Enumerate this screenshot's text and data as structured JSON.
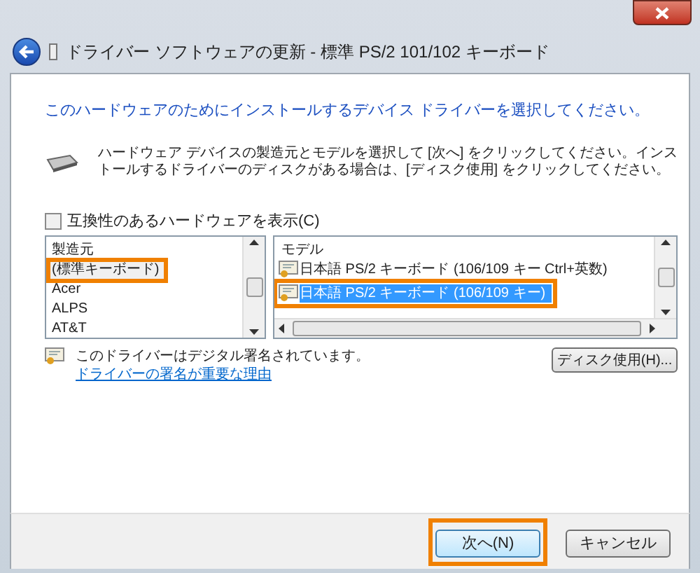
{
  "window": {
    "title": "ドライバー ソフトウェアの更新 - 標準 PS/2 101/102 キーボード"
  },
  "heading": "このハードウェアのためにインストールするデバイス ドライバーを選択してください。",
  "description": "ハードウェア デバイスの製造元とモデルを選択して [次へ] をクリックしてください。インストールするドライバーのディスクがある場合は、[ディスク使用] をクリックしてください。",
  "compatible_checkbox": {
    "label": "互換性のあるハードウェアを表示(C)",
    "checked": false
  },
  "manufacturers": {
    "header": "製造元",
    "items": [
      {
        "label": "(標準キーボード)",
        "selected": true,
        "highlighted": true
      },
      {
        "label": "Acer",
        "selected": false,
        "highlighted": false
      },
      {
        "label": "ALPS",
        "selected": false,
        "highlighted": false
      },
      {
        "label": "AT&T",
        "selected": false,
        "highlighted": false
      }
    ]
  },
  "models": {
    "header": "モデル",
    "items": [
      {
        "label": "日本語 PS/2 キーボード (106/109 キー Ctrl+英数)",
        "selected": false,
        "highlighted": false
      },
      {
        "label": "日本語 PS/2 キーボード (106/109 キー)",
        "selected": true,
        "highlighted": true
      }
    ]
  },
  "signed_text": "このドライバーはデジタル署名されています。",
  "signed_link": "ドライバーの署名が重要な理由",
  "disk_button": "ディスク使用(H)...",
  "buttons": [
    {
      "label": "次へ(N)",
      "kind": "default",
      "highlighted": true
    },
    {
      "label": "キャンセル",
      "kind": "normal",
      "highlighted": false
    }
  ]
}
